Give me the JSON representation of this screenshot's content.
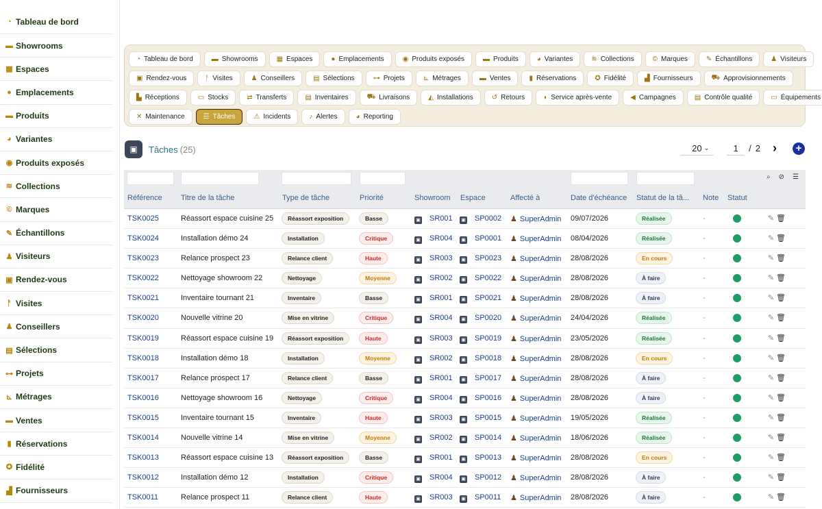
{
  "sidebar": {
    "items": [
      {
        "label": "Tableau de bord",
        "icon": "dashboard-icon",
        "glyph": "◔"
      },
      {
        "label": "Showrooms",
        "icon": "showroom-icon",
        "glyph": "▬"
      },
      {
        "label": "Espaces",
        "icon": "grid-icon",
        "glyph": "▦"
      },
      {
        "label": "Emplacements",
        "icon": "location-pin-icon",
        "glyph": "●"
      },
      {
        "label": "Produits",
        "icon": "couch-icon",
        "glyph": "▬"
      },
      {
        "label": "Variantes",
        "icon": "palette-icon",
        "glyph": "◕"
      },
      {
        "label": "Produits exposés",
        "icon": "eye-icon",
        "glyph": "◉"
      },
      {
        "label": "Collections",
        "icon": "layers-icon",
        "glyph": "≋"
      },
      {
        "label": "Marques",
        "icon": "copyright-icon",
        "glyph": "©"
      },
      {
        "label": "Échantillons",
        "icon": "brush-icon",
        "glyph": "✎"
      },
      {
        "label": "Visiteurs",
        "icon": "users-icon",
        "glyph": "♟"
      },
      {
        "label": "Rendez-vous",
        "icon": "calendar-check-icon",
        "glyph": "▣"
      },
      {
        "label": "Visites",
        "icon": "walking-icon",
        "glyph": "ᚨ"
      },
      {
        "label": "Conseillers",
        "icon": "user-tie-icon",
        "glyph": "♟"
      },
      {
        "label": "Sélections",
        "icon": "clipboard-icon",
        "glyph": "▤"
      },
      {
        "label": "Projets",
        "icon": "project-diagram-icon",
        "glyph": "⊶"
      },
      {
        "label": "Métrages",
        "icon": "ruler-icon",
        "glyph": "⊾"
      },
      {
        "label": "Ventes",
        "icon": "cash-icon",
        "glyph": "▬"
      },
      {
        "label": "Réservations",
        "icon": "bookmark-icon",
        "glyph": "▮"
      },
      {
        "label": "Fidélité",
        "icon": "award-icon",
        "glyph": "✪"
      },
      {
        "label": "Fournisseurs",
        "icon": "industry-icon",
        "glyph": "▟"
      }
    ]
  },
  "modules": {
    "rows": [
      [
        {
          "label": "Tableau de bord",
          "glyph": "◔",
          "icon": "dashboard-icon"
        },
        {
          "label": "Showrooms",
          "glyph": "▬",
          "icon": "showroom-icon"
        },
        {
          "label": "Espaces",
          "glyph": "▦",
          "icon": "grid-icon"
        },
        {
          "label": "Emplacements",
          "glyph": "●",
          "icon": "location-pin-icon"
        },
        {
          "label": "Produits exposés",
          "glyph": "◉",
          "icon": "eye-icon"
        },
        {
          "label": "Produits",
          "glyph": "▬",
          "icon": "couch-icon"
        },
        {
          "label": "Variantes",
          "glyph": "◕",
          "icon": "palette-icon"
        },
        {
          "label": "Collections",
          "glyph": "≋",
          "icon": "layers-icon"
        },
        {
          "label": "Marques",
          "glyph": "©",
          "icon": "copyright-icon"
        },
        {
          "label": "Échantillons",
          "glyph": "✎",
          "icon": "brush-icon"
        },
        {
          "label": "Visiteurs",
          "glyph": "♟",
          "icon": "users-icon"
        }
      ],
      [
        {
          "label": "Rendez-vous",
          "glyph": "▣",
          "icon": "calendar-check-icon"
        },
        {
          "label": "Visites",
          "glyph": "ᚨ",
          "icon": "walking-icon"
        },
        {
          "label": "Conseillers",
          "glyph": "♟",
          "icon": "user-tie-icon"
        },
        {
          "label": "Sélections",
          "glyph": "▤",
          "icon": "clipboard-icon"
        },
        {
          "label": "Projets",
          "glyph": "⊶",
          "icon": "project-diagram-icon"
        },
        {
          "label": "Métrages",
          "glyph": "⊾",
          "icon": "ruler-icon"
        },
        {
          "label": "Ventes",
          "glyph": "▬",
          "icon": "cash-icon"
        },
        {
          "label": "Réservations",
          "glyph": "▮",
          "icon": "bookmark-icon"
        },
        {
          "label": "Fidélité",
          "glyph": "✪",
          "icon": "award-icon"
        },
        {
          "label": "Fournisseurs",
          "glyph": "▟",
          "icon": "industry-icon"
        },
        {
          "label": "Approvisionnements",
          "glyph": "⛟",
          "icon": "dolly-icon"
        }
      ],
      [
        {
          "label": "Réceptions",
          "glyph": "▙",
          "icon": "truck-loading-icon"
        },
        {
          "label": "Stocks",
          "glyph": "▭",
          "icon": "warehouse-icon"
        },
        {
          "label": "Transferts",
          "glyph": "⇄",
          "icon": "exchange-icon"
        },
        {
          "label": "Inventaires",
          "glyph": "▤",
          "icon": "clipboard-list-icon"
        },
        {
          "label": "Livraisons",
          "glyph": "⛟",
          "icon": "truck-icon"
        },
        {
          "label": "Installations",
          "glyph": "◭",
          "icon": "hard-hat-icon"
        },
        {
          "label": "Retours",
          "glyph": "↺",
          "icon": "undo-icon"
        },
        {
          "label": "Service après-vente",
          "glyph": "◗",
          "icon": "comment-icon"
        },
        {
          "label": "Campagnes",
          "glyph": "◀",
          "icon": "bullhorn-icon"
        },
        {
          "label": "Contrôle qualité",
          "glyph": "▤",
          "icon": "clipboard-check-icon"
        },
        {
          "label": "Équipements",
          "glyph": "▭",
          "icon": "desktop-icon"
        }
      ],
      [
        {
          "label": "Maintenance",
          "glyph": "✕",
          "icon": "tools-icon"
        },
        {
          "label": "Tâches",
          "glyph": "☰",
          "icon": "tasks-icon",
          "active": true
        },
        {
          "label": "Incidents",
          "glyph": "⚠",
          "icon": "warning-icon"
        },
        {
          "label": "Alertes",
          "glyph": "♪",
          "icon": "bell-icon"
        },
        {
          "label": "Reporting",
          "glyph": "◕",
          "icon": "chart-pie-icon"
        }
      ]
    ]
  },
  "header": {
    "title": "Tâches",
    "count": "(25)",
    "per_page": "20",
    "current_page": "1",
    "separator": "/",
    "total_pages": "2"
  },
  "table": {
    "columns": [
      "Référence",
      "Titre de la tâche",
      "Type de tâche",
      "Priorité",
      "Showroom",
      "Espace",
      "Affecté à",
      "Date d'échéance",
      "Statut de la tâ...",
      "Note",
      "Statut"
    ],
    "rows": [
      {
        "ref": "TSK0025",
        "title": "Réassort espace cuisine 25",
        "type": "Réassort exposition",
        "priority": "Basse",
        "showroom": "SR001",
        "space": "SP0002",
        "assignee": "SuperAdmin",
        "due": "09/07/2026",
        "status": "Réalisée",
        "note": "-"
      },
      {
        "ref": "TSK0024",
        "title": "Installation démo 24",
        "type": "Installation",
        "priority": "Critique",
        "showroom": "SR004",
        "space": "SP0001",
        "assignee": "SuperAdmin",
        "due": "08/04/2026",
        "status": "Réalisée",
        "note": "-"
      },
      {
        "ref": "TSK0023",
        "title": "Relance prospect 23",
        "type": "Relance client",
        "priority": "Haute",
        "showroom": "SR003",
        "space": "SP0023",
        "assignee": "SuperAdmin",
        "due": "28/08/2026",
        "status": "En cours",
        "note": "-"
      },
      {
        "ref": "TSK0022",
        "title": "Nettoyage showroom 22",
        "type": "Nettoyage",
        "priority": "Moyenne",
        "showroom": "SR002",
        "space": "SP0022",
        "assignee": "SuperAdmin",
        "due": "28/08/2026",
        "status": "À faire",
        "note": "-"
      },
      {
        "ref": "TSK0021",
        "title": "Inventaire tournant 21",
        "type": "Inventaire",
        "priority": "Basse",
        "showroom": "SR001",
        "space": "SP0021",
        "assignee": "SuperAdmin",
        "due": "28/08/2026",
        "status": "À faire",
        "note": "-"
      },
      {
        "ref": "TSK0020",
        "title": "Nouvelle vitrine 20",
        "type": "Mise en vitrine",
        "priority": "Critique",
        "showroom": "SR004",
        "space": "SP0020",
        "assignee": "SuperAdmin",
        "due": "24/04/2026",
        "status": "Réalisée",
        "note": "-"
      },
      {
        "ref": "TSK0019",
        "title": "Réassort espace cuisine 19",
        "type": "Réassort exposition",
        "priority": "Haute",
        "showroom": "SR003",
        "space": "SP0019",
        "assignee": "SuperAdmin",
        "due": "23/05/2026",
        "status": "Réalisée",
        "note": "-"
      },
      {
        "ref": "TSK0018",
        "title": "Installation démo 18",
        "type": "Installation",
        "priority": "Moyenne",
        "showroom": "SR002",
        "space": "SP0018",
        "assignee": "SuperAdmin",
        "due": "28/08/2026",
        "status": "En cours",
        "note": "-"
      },
      {
        "ref": "TSK0017",
        "title": "Relance prospect 17",
        "type": "Relance client",
        "priority": "Basse",
        "showroom": "SR001",
        "space": "SP0017",
        "assignee": "SuperAdmin",
        "due": "28/08/2026",
        "status": "À faire",
        "note": "-"
      },
      {
        "ref": "TSK0016",
        "title": "Nettoyage showroom 16",
        "type": "Nettoyage",
        "priority": "Critique",
        "showroom": "SR004",
        "space": "SP0016",
        "assignee": "SuperAdmin",
        "due": "28/08/2026",
        "status": "À faire",
        "note": "-"
      },
      {
        "ref": "TSK0015",
        "title": "Inventaire tournant 15",
        "type": "Inventaire",
        "priority": "Haute",
        "showroom": "SR003",
        "space": "SP0015",
        "assignee": "SuperAdmin",
        "due": "19/05/2026",
        "status": "Réalisée",
        "note": "-"
      },
      {
        "ref": "TSK0014",
        "title": "Nouvelle vitrine 14",
        "type": "Mise en vitrine",
        "priority": "Moyenne",
        "showroom": "SR002",
        "space": "SP0014",
        "assignee": "SuperAdmin",
        "due": "18/06/2026",
        "status": "Réalisée",
        "note": "-"
      },
      {
        "ref": "TSK0013",
        "title": "Réassort espace cuisine 13",
        "type": "Réassort exposition",
        "priority": "Basse",
        "showroom": "SR001",
        "space": "SP0013",
        "assignee": "SuperAdmin",
        "due": "28/08/2026",
        "status": "En cours",
        "note": "-"
      },
      {
        "ref": "TSK0012",
        "title": "Installation démo 12",
        "type": "Installation",
        "priority": "Critique",
        "showroom": "SR004",
        "space": "SP0012",
        "assignee": "SuperAdmin",
        "due": "28/08/2026",
        "status": "À faire",
        "note": "-"
      },
      {
        "ref": "TSK0011",
        "title": "Relance prospect 11",
        "type": "Relance client",
        "priority": "Haute",
        "showroom": "SR003",
        "space": "SP0011",
        "assignee": "SuperAdmin",
        "due": "28/08/2026",
        "status": "À faire",
        "note": "-"
      }
    ]
  },
  "colors": {
    "accent": "#c9a53e",
    "sidebar_text": "#1f3a12",
    "link": "#1a3d8f",
    "active_dot": "#1f9d69",
    "add_button": "#1a2fa0"
  }
}
